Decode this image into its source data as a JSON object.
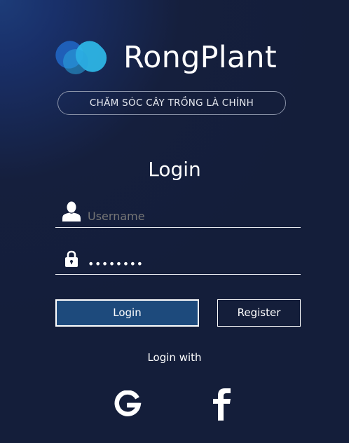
{
  "brand": {
    "name": "RongPlant",
    "tagline": "CHĂM SÓC CÂY TRỒNG LÀ CHÍNH",
    "logo_icon": "heart-logo-icon",
    "colors": {
      "logo_dark": "#1f5fb8",
      "logo_light": "#2fb8e8",
      "background": "#141e3a",
      "login_button": "#1d4a7c"
    }
  },
  "form": {
    "title": "Login",
    "username": {
      "icon": "user-icon",
      "placeholder": "Username",
      "value": ""
    },
    "password": {
      "icon": "lock-icon",
      "value": "12345678"
    },
    "login_label": "Login",
    "register_label": "Register"
  },
  "social": {
    "label": "Login with",
    "providers": [
      {
        "name": "google",
        "icon": "google-icon"
      },
      {
        "name": "facebook",
        "icon": "facebook-icon"
      }
    ]
  }
}
